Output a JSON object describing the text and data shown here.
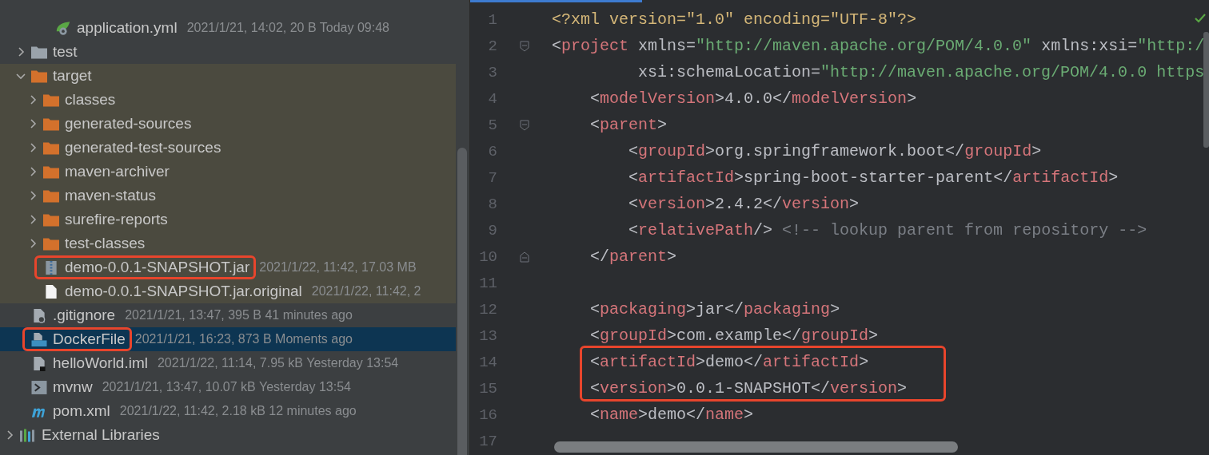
{
  "project_tree": [
    {
      "name": "application.yml",
      "kind": "yml",
      "meta": "2021/1/21, 14:02, 20 B Today 09:48",
      "selected": false,
      "marked": false
    },
    {
      "name": "test",
      "kind": "folder",
      "expanded": false,
      "selected": false,
      "marked": false
    },
    {
      "name": "target",
      "kind": "excluded-folder",
      "expanded": true,
      "selected": false,
      "marked": false,
      "children": [
        {
          "name": "classes",
          "kind": "excluded-folder",
          "expanded": false,
          "selected": false,
          "marked": false
        },
        {
          "name": "generated-sources",
          "kind": "excluded-folder",
          "expanded": false,
          "selected": false,
          "marked": false
        },
        {
          "name": "generated-test-sources",
          "kind": "excluded-folder",
          "expanded": false,
          "selected": false,
          "marked": false
        },
        {
          "name": "maven-archiver",
          "kind": "excluded-folder",
          "expanded": false,
          "selected": false,
          "marked": false
        },
        {
          "name": "maven-status",
          "kind": "excluded-folder",
          "expanded": false,
          "selected": false,
          "marked": false
        },
        {
          "name": "surefire-reports",
          "kind": "excluded-folder",
          "expanded": false,
          "selected": false,
          "marked": false
        },
        {
          "name": "test-classes",
          "kind": "excluded-folder",
          "expanded": false,
          "selected": false,
          "marked": false
        },
        {
          "name": "demo-0.0.1-SNAPSHOT.jar",
          "kind": "jar",
          "meta": "2021/1/22, 11:42, 17.03 MB",
          "selected": false,
          "marked": true
        },
        {
          "name": "demo-0.0.1-SNAPSHOT.jar.original",
          "kind": "file",
          "meta": "2021/1/22, 11:42, 2",
          "selected": false,
          "marked": false
        }
      ]
    },
    {
      "name": ".gitignore",
      "kind": "gitignore",
      "meta": "2021/1/21, 13:47, 395 B 41 minutes ago",
      "selected": false,
      "marked": false
    },
    {
      "name": "DockerFile",
      "kind": "docker",
      "meta": "2021/1/21, 16:23, 873 B Moments ago",
      "selected": true,
      "marked": true
    },
    {
      "name": "helloWorld.iml",
      "kind": "iml",
      "meta": "2021/1/22, 11:14, 7.95 kB Yesterday 13:54",
      "selected": false,
      "marked": false
    },
    {
      "name": "mvnw",
      "kind": "shell",
      "meta": "2021/1/21, 13:47, 10.07 kB Yesterday 13:54",
      "selected": false,
      "marked": false
    },
    {
      "name": "pom.xml",
      "kind": "maven",
      "meta": "2021/1/22, 11:42, 2.18 kB 12 minutes ago",
      "selected": false,
      "marked": false
    }
  ],
  "external_libraries": {
    "name": "External Libraries",
    "expanded": false
  },
  "editor": {
    "lines": [
      {
        "number": "1",
        "marked": false,
        "tokens": [
          {
            "kind": "decl",
            "text": "<?xml version=\"1.0\" encoding=\"UTF-8\"?>"
          }
        ]
      },
      {
        "number": "2",
        "marked": false,
        "fold_start": true,
        "tokens": [
          {
            "kind": "punct",
            "text": "<"
          },
          {
            "kind": "tag",
            "text": "project"
          },
          {
            "kind": "attr",
            "text": " xmlns="
          },
          {
            "kind": "string",
            "text": "\"http://maven.apache.org/POM/4.0.0\""
          },
          {
            "kind": "attr",
            "text": " xmlns:xsi="
          },
          {
            "kind": "string",
            "text": "\"http:/"
          }
        ]
      },
      {
        "number": "3",
        "marked": false,
        "tokens": [
          {
            "kind": "attr",
            "text": "         xsi:schemaLocation="
          },
          {
            "kind": "string",
            "text": "\"http://maven.apache.org/POM/4.0.0 https"
          }
        ]
      },
      {
        "number": "4",
        "marked": false,
        "tokens": [
          {
            "kind": "punct",
            "text": "    <"
          },
          {
            "kind": "tag",
            "text": "modelVersion"
          },
          {
            "kind": "punct",
            "text": ">"
          },
          {
            "kind": "text",
            "text": "4.0.0"
          },
          {
            "kind": "punct",
            "text": "</"
          },
          {
            "kind": "tag",
            "text": "modelVersion"
          },
          {
            "kind": "punct",
            "text": ">"
          }
        ]
      },
      {
        "number": "5",
        "marked": false,
        "fold_start": true,
        "tokens": [
          {
            "kind": "punct",
            "text": "    <"
          },
          {
            "kind": "tag",
            "text": "parent"
          },
          {
            "kind": "punct",
            "text": ">"
          }
        ]
      },
      {
        "number": "6",
        "marked": false,
        "tokens": [
          {
            "kind": "punct",
            "text": "        <"
          },
          {
            "kind": "tag",
            "text": "groupId"
          },
          {
            "kind": "punct",
            "text": ">"
          },
          {
            "kind": "text",
            "text": "org.springframework.boot"
          },
          {
            "kind": "punct",
            "text": "</"
          },
          {
            "kind": "tag",
            "text": "groupId"
          },
          {
            "kind": "punct",
            "text": ">"
          }
        ]
      },
      {
        "number": "7",
        "marked": false,
        "tokens": [
          {
            "kind": "punct",
            "text": "        <"
          },
          {
            "kind": "tag",
            "text": "artifactId"
          },
          {
            "kind": "punct",
            "text": ">"
          },
          {
            "kind": "text",
            "text": "spring-boot-starter-parent"
          },
          {
            "kind": "punct",
            "text": "</"
          },
          {
            "kind": "tag",
            "text": "artifactId"
          },
          {
            "kind": "punct",
            "text": ">"
          }
        ]
      },
      {
        "number": "8",
        "marked": false,
        "tokens": [
          {
            "kind": "punct",
            "text": "        <"
          },
          {
            "kind": "tag",
            "text": "version"
          },
          {
            "kind": "punct",
            "text": ">"
          },
          {
            "kind": "text",
            "text": "2.4.2"
          },
          {
            "kind": "punct",
            "text": "</"
          },
          {
            "kind": "tag",
            "text": "version"
          },
          {
            "kind": "punct",
            "text": ">"
          }
        ]
      },
      {
        "number": "9",
        "marked": false,
        "tokens": [
          {
            "kind": "punct",
            "text": "        <"
          },
          {
            "kind": "tag",
            "text": "relativePath"
          },
          {
            "kind": "punct",
            "text": "/>"
          },
          {
            "kind": "comment",
            "text": " <!-- lookup parent from repository -->"
          }
        ]
      },
      {
        "number": "10",
        "marked": false,
        "fold_end": true,
        "tokens": [
          {
            "kind": "punct",
            "text": "    </"
          },
          {
            "kind": "tag",
            "text": "parent"
          },
          {
            "kind": "punct",
            "text": ">"
          }
        ]
      },
      {
        "number": "11",
        "marked": false
      },
      {
        "number": "12",
        "marked": false,
        "tokens": [
          {
            "kind": "punct",
            "text": "    <"
          },
          {
            "kind": "tag",
            "text": "packaging"
          },
          {
            "kind": "punct",
            "text": ">"
          },
          {
            "kind": "text",
            "text": "jar"
          },
          {
            "kind": "punct",
            "text": "</"
          },
          {
            "kind": "tag",
            "text": "packaging"
          },
          {
            "kind": "punct",
            "text": ">"
          }
        ]
      },
      {
        "number": "13",
        "marked": false,
        "tokens": [
          {
            "kind": "punct",
            "text": "    <"
          },
          {
            "kind": "tag",
            "text": "groupId"
          },
          {
            "kind": "punct",
            "text": ">"
          },
          {
            "kind": "text",
            "text": "com.example"
          },
          {
            "kind": "punct",
            "text": "</"
          },
          {
            "kind": "tag",
            "text": "groupId"
          },
          {
            "kind": "punct",
            "text": ">"
          }
        ]
      },
      {
        "number": "14",
        "marked": true,
        "tokens": [
          {
            "kind": "punct",
            "text": "    <"
          },
          {
            "kind": "tag",
            "text": "artifactId"
          },
          {
            "kind": "punct",
            "text": ">"
          },
          {
            "kind": "text",
            "text": "demo"
          },
          {
            "kind": "punct",
            "text": "</"
          },
          {
            "kind": "tag",
            "text": "artifactId"
          },
          {
            "kind": "punct",
            "text": ">"
          }
        ]
      },
      {
        "number": "15",
        "marked": true,
        "tokens": [
          {
            "kind": "punct",
            "text": "    <"
          },
          {
            "kind": "tag",
            "text": "version"
          },
          {
            "kind": "punct",
            "text": ">"
          },
          {
            "kind": "text",
            "text": "0.0.1-SNAPSHOT"
          },
          {
            "kind": "punct",
            "text": "</"
          },
          {
            "kind": "tag",
            "text": "version"
          },
          {
            "kind": "punct",
            "text": ">"
          }
        ]
      },
      {
        "number": "16",
        "marked": false,
        "tokens": [
          {
            "kind": "punct",
            "text": "    <"
          },
          {
            "kind": "tag",
            "text": "name"
          },
          {
            "kind": "punct",
            "text": ">"
          },
          {
            "kind": "text",
            "text": "demo"
          },
          {
            "kind": "punct",
            "text": "</"
          },
          {
            "kind": "tag",
            "text": "name"
          },
          {
            "kind": "punct",
            "text": ">"
          }
        ]
      },
      {
        "number": "17",
        "marked": false
      }
    ]
  }
}
